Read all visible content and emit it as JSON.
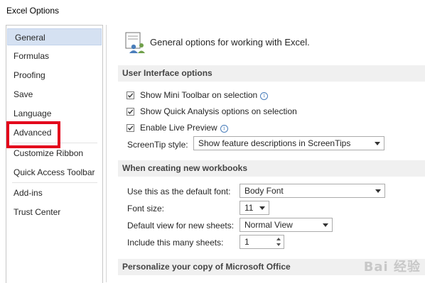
{
  "window": {
    "title": "Excel Options"
  },
  "sidebar": {
    "items": [
      {
        "label": "General"
      },
      {
        "label": "Formulas"
      },
      {
        "label": "Proofing"
      },
      {
        "label": "Save"
      },
      {
        "label": "Language"
      },
      {
        "label": "Advanced"
      },
      {
        "label": "Customize Ribbon"
      },
      {
        "label": "Quick Access Toolbar"
      },
      {
        "label": "Add-ins"
      },
      {
        "label": "Trust Center"
      }
    ],
    "selected": "General"
  },
  "main": {
    "header": "General options for working with Excel.",
    "ui_options": {
      "title": "User Interface options",
      "mini_toolbar": {
        "label": "Show Mini Toolbar on selection",
        "checked": true
      },
      "quick_analysis": {
        "label": "Show Quick Analysis options on selection",
        "checked": true
      },
      "live_preview": {
        "label": "Enable Live Preview",
        "checked": true
      },
      "screentip_label": "ScreenTip style:",
      "screentip_value": "Show feature descriptions in ScreenTips"
    },
    "new_workbooks": {
      "title": "When creating new workbooks",
      "font_label": "Use this as the default font:",
      "font_value": "Body Font",
      "size_label": "Font size:",
      "size_value": "11",
      "view_label": "Default view for new sheets:",
      "view_value": "Normal View",
      "sheets_label": "Include this many sheets:",
      "sheets_value": "1"
    },
    "personalize": {
      "title": "Personalize your copy of Microsoft Office"
    }
  },
  "watermark": "Bai 经验",
  "colors": {
    "annotation": "#e3001b",
    "selected_bg": "#d5e1f2",
    "section_bg": "#f0f0f0"
  }
}
